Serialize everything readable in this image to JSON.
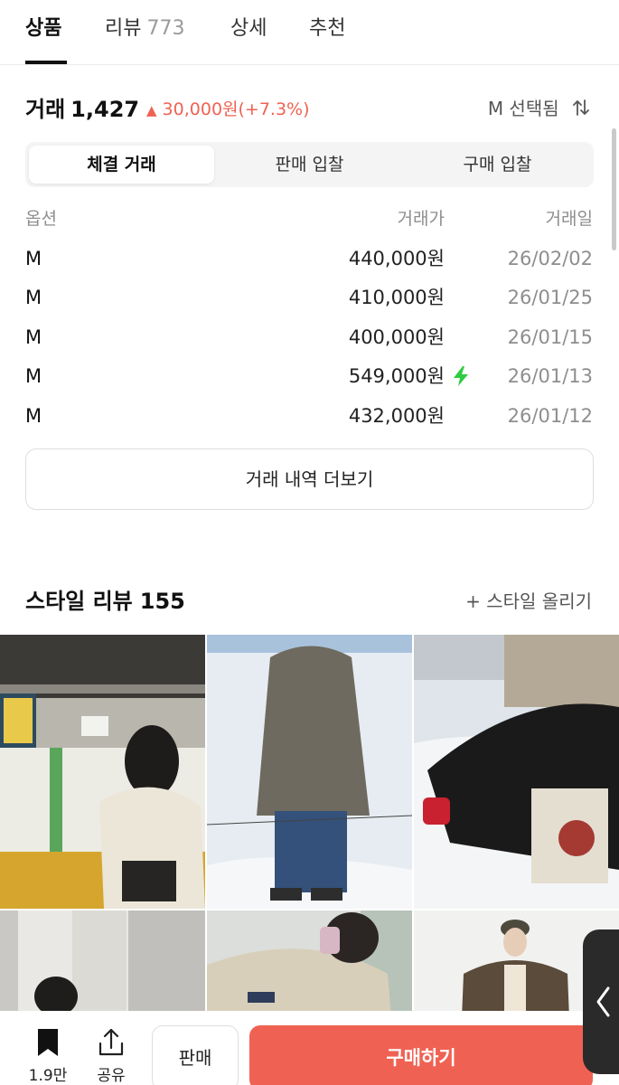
{
  "tabs": [
    {
      "label": "상품"
    },
    {
      "label": "리뷰",
      "count": "773"
    },
    {
      "label": "상세"
    },
    {
      "label": "추천"
    }
  ],
  "trade": {
    "title": "거래",
    "count": "1,427",
    "change": "30,000원(+7.3%)",
    "up_symbol": "▲",
    "size_selected": "M 선택됨",
    "sort_icon": "swap-vert-icon"
  },
  "segments": [
    "체결 거래",
    "판매 입찰",
    "구매 입찰"
  ],
  "table": {
    "headers": {
      "option": "옵션",
      "price": "거래가",
      "date": "거래일"
    },
    "rows": [
      {
        "option": "M",
        "price": "440,000원",
        "date": "26/02/02",
        "quick": false
      },
      {
        "option": "M",
        "price": "410,000원",
        "date": "26/01/25",
        "quick": false
      },
      {
        "option": "M",
        "price": "400,000원",
        "date": "26/01/15",
        "quick": false
      },
      {
        "option": "M",
        "price": "549,000원",
        "date": "26/01/13",
        "quick": true
      },
      {
        "option": "M",
        "price": "432,000원",
        "date": "26/01/12",
        "quick": false
      }
    ]
  },
  "more_label": "거래 내역 더보기",
  "reviews": {
    "title": "스타일 리뷰",
    "count": "155",
    "upload_label": "+ 스타일 올리기"
  },
  "bottom": {
    "bookmark_count": "1.9만",
    "share_label": "공유",
    "sell_label": "판매",
    "buy_label": "구매하기"
  },
  "colors": {
    "accent": "#ef6253",
    "quick_green": "#2ecc40"
  }
}
